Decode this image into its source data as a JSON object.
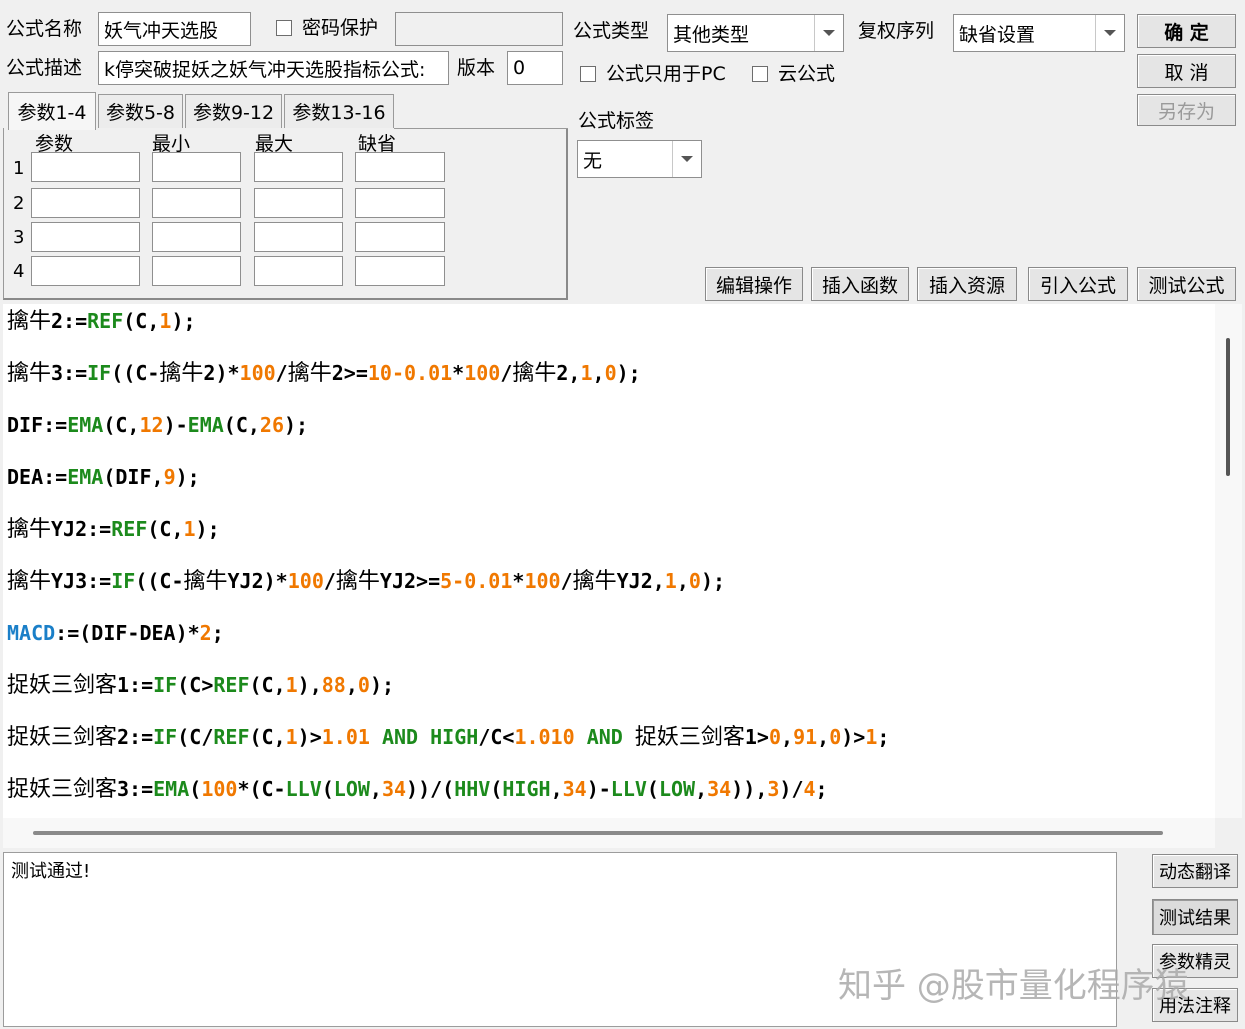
{
  "header": {
    "name_label": "公式名称",
    "name_value": "妖气冲天选股",
    "password_label": "密码保护",
    "password_value": "",
    "desc_label": "公式描述",
    "desc_value": "k停突破捉妖之妖气冲天选股指标公式:",
    "version_label": "版本",
    "version_value": "0",
    "type_label": "公式类型",
    "type_value": "其他类型",
    "rights_label": "复权序列",
    "rights_value": "缺省设置",
    "pc_only_label": "公式只用于PC",
    "cloud_label": "云公式",
    "tag_label": "公式标签",
    "tag_value": "无"
  },
  "buttons": {
    "ok": "确  定",
    "cancel": "取  消",
    "save_as": "另存为",
    "edit_ops": "编辑操作",
    "insert_func": "插入函数",
    "insert_res": "插入资源",
    "import_formula": "引入公式",
    "test_formula": "测试公式",
    "dyn_translate": "动态翻译",
    "test_result": "测试结果",
    "param_wizard": "参数精灵",
    "usage_notes": "用法注释"
  },
  "tabs": [
    "参数1-4",
    "参数5-8",
    "参数9-12",
    "参数13-16"
  ],
  "params": {
    "headers": [
      "参数",
      "最小",
      "最大",
      "缺省"
    ],
    "rows": [
      "1",
      "2",
      "3",
      "4"
    ]
  },
  "code_lines": [
    [
      [
        "z",
        "擒牛"
      ],
      [
        "t",
        "2:="
      ],
      [
        "k",
        "REF"
      ],
      [
        "t",
        "(C,"
      ],
      [
        "n",
        "1"
      ],
      [
        "t",
        ");"
      ]
    ],
    [
      [
        "z",
        "擒牛"
      ],
      [
        "t",
        "3:="
      ],
      [
        "k",
        "IF"
      ],
      [
        "t",
        "((C-"
      ],
      [
        "z",
        "擒牛"
      ],
      [
        "t",
        "2)*"
      ],
      [
        "n",
        "100"
      ],
      [
        "t",
        "/"
      ],
      [
        "z",
        "擒牛"
      ],
      [
        "t",
        "2>="
      ],
      [
        "n",
        "10-0.01"
      ],
      [
        "t",
        "*"
      ],
      [
        "n",
        "100"
      ],
      [
        "t",
        "/"
      ],
      [
        "z",
        "擒牛"
      ],
      [
        "t",
        "2,"
      ],
      [
        "n",
        "1"
      ],
      [
        "t",
        ","
      ],
      [
        "n",
        "0"
      ],
      [
        "t",
        ");"
      ]
    ],
    [
      [
        "t",
        "DIF:="
      ],
      [
        "k",
        "EMA"
      ],
      [
        "t",
        "(C,"
      ],
      [
        "n",
        "12"
      ],
      [
        "t",
        ")-"
      ],
      [
        "k",
        "EMA"
      ],
      [
        "t",
        "(C,"
      ],
      [
        "n",
        "26"
      ],
      [
        "t",
        ");"
      ]
    ],
    [
      [
        "t",
        "DEA:="
      ],
      [
        "k",
        "EMA"
      ],
      [
        "t",
        "(DIF,"
      ],
      [
        "n",
        "9"
      ],
      [
        "t",
        ");"
      ]
    ],
    [
      [
        "z",
        "擒牛"
      ],
      [
        "t",
        "YJ2:="
      ],
      [
        "k",
        "REF"
      ],
      [
        "t",
        "(C,"
      ],
      [
        "n",
        "1"
      ],
      [
        "t",
        ");"
      ]
    ],
    [
      [
        "z",
        "擒牛"
      ],
      [
        "t",
        "YJ3:="
      ],
      [
        "k",
        "IF"
      ],
      [
        "t",
        "((C-"
      ],
      [
        "z",
        "擒牛"
      ],
      [
        "t",
        "YJ2)*"
      ],
      [
        "n",
        "100"
      ],
      [
        "t",
        "/"
      ],
      [
        "z",
        "擒牛"
      ],
      [
        "t",
        "YJ2>="
      ],
      [
        "n",
        "5-0.01"
      ],
      [
        "t",
        "*"
      ],
      [
        "n",
        "100"
      ],
      [
        "t",
        "/"
      ],
      [
        "z",
        "擒牛"
      ],
      [
        "t",
        "YJ2,"
      ],
      [
        "n",
        "1"
      ],
      [
        "t",
        ","
      ],
      [
        "n",
        "0"
      ],
      [
        "t",
        ");"
      ]
    ],
    [
      [
        "m",
        "MACD"
      ],
      [
        "t",
        ":=(DIF-DEA)*"
      ],
      [
        "n",
        "2"
      ],
      [
        "t",
        ";"
      ]
    ],
    [
      [
        "z",
        "捉妖三剑客"
      ],
      [
        "t",
        "1:="
      ],
      [
        "k",
        "IF"
      ],
      [
        "t",
        "(C>"
      ],
      [
        "k",
        "REF"
      ],
      [
        "t",
        "(C,"
      ],
      [
        "n",
        "1"
      ],
      [
        "t",
        "),"
      ],
      [
        "n",
        "88"
      ],
      [
        "t",
        ","
      ],
      [
        "n",
        "0"
      ],
      [
        "t",
        ");"
      ]
    ],
    [
      [
        "z",
        "捉妖三剑客"
      ],
      [
        "t",
        "2:="
      ],
      [
        "k",
        "IF"
      ],
      [
        "t",
        "(C/"
      ],
      [
        "k",
        "REF"
      ],
      [
        "t",
        "(C,"
      ],
      [
        "n",
        "1"
      ],
      [
        "t",
        ")>"
      ],
      [
        "n",
        "1.01"
      ],
      [
        "t",
        " "
      ],
      [
        "k",
        "AND"
      ],
      [
        "t",
        " "
      ],
      [
        "k",
        "HIGH"
      ],
      [
        "t",
        "/C<"
      ],
      [
        "n",
        "1.010"
      ],
      [
        "t",
        " "
      ],
      [
        "k",
        "AND"
      ],
      [
        "t",
        " "
      ],
      [
        "z",
        "捉妖三剑客"
      ],
      [
        "t",
        "1>"
      ],
      [
        "n",
        "0"
      ],
      [
        "t",
        ","
      ],
      [
        "n",
        "91"
      ],
      [
        "t",
        ","
      ],
      [
        "n",
        "0"
      ],
      [
        "t",
        ")>"
      ],
      [
        "n",
        "1"
      ],
      [
        "t",
        ";"
      ]
    ],
    [
      [
        "z",
        "捉妖三剑客"
      ],
      [
        "t",
        "3:="
      ],
      [
        "k",
        "EMA"
      ],
      [
        "t",
        "("
      ],
      [
        "n",
        "100"
      ],
      [
        "t",
        "*(C-"
      ],
      [
        "k",
        "LLV"
      ],
      [
        "t",
        "("
      ],
      [
        "k",
        "LOW"
      ],
      [
        "t",
        ","
      ],
      [
        "n",
        "34"
      ],
      [
        "t",
        "))/("
      ],
      [
        "k",
        "HHV"
      ],
      [
        "t",
        "("
      ],
      [
        "k",
        "HIGH"
      ],
      [
        "t",
        ","
      ],
      [
        "n",
        "34"
      ],
      [
        "t",
        ")-"
      ],
      [
        "k",
        "LLV"
      ],
      [
        "t",
        "("
      ],
      [
        "k",
        "LOW"
      ],
      [
        "t",
        ","
      ],
      [
        "n",
        "34"
      ],
      [
        "t",
        ")),"
      ],
      [
        "n",
        "3"
      ],
      [
        "t",
        ")/"
      ],
      [
        "n",
        "4"
      ],
      [
        "t",
        ";"
      ]
    ]
  ],
  "output_text": "测试通过!",
  "watermark": "知乎 @股市量化程序猿"
}
